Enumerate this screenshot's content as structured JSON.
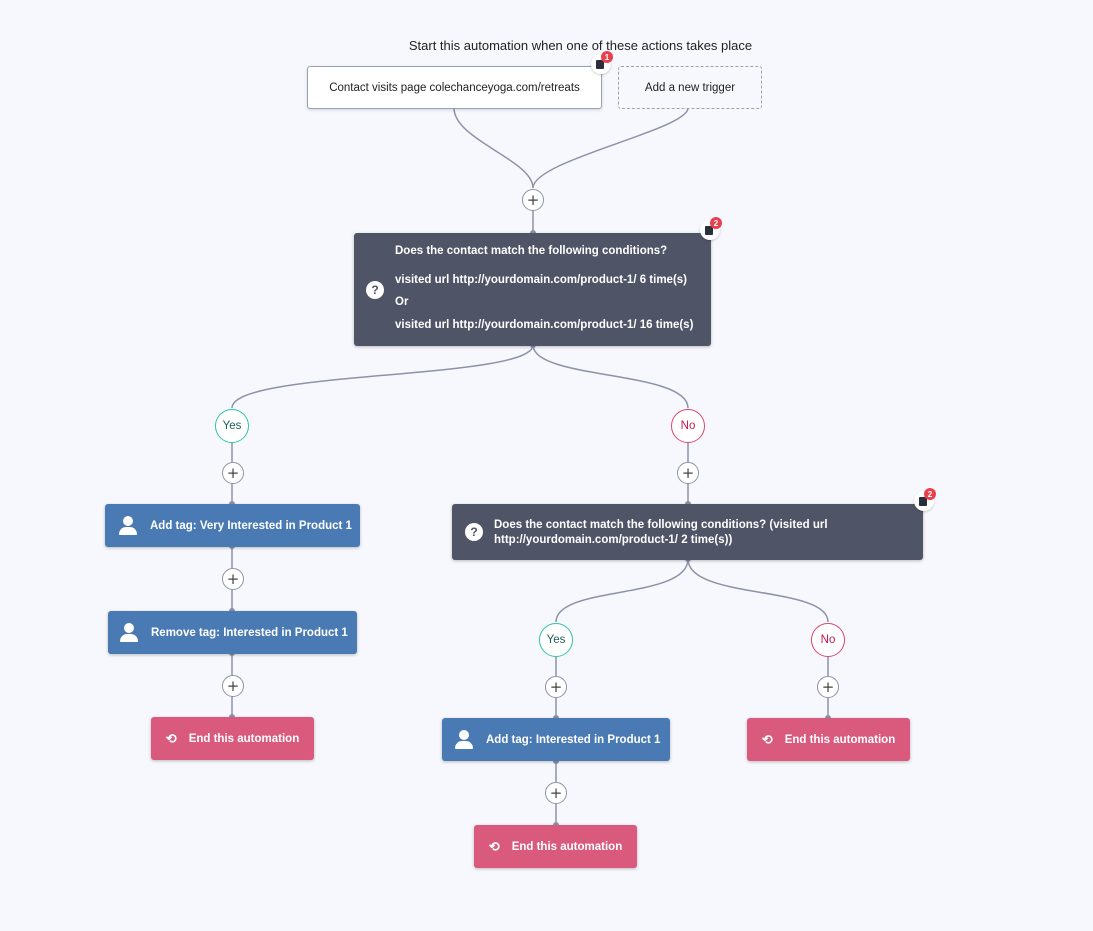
{
  "header": {
    "title": "Start this automation when one of these actions takes place"
  },
  "triggers": [
    {
      "label": "Contact visits page colechanceyoga.com/retreats",
      "badge_count": "1",
      "badge_icon": "note-icon"
    },
    {
      "label": "Add a new trigger"
    }
  ],
  "add_step_symbol": "+",
  "condition1": {
    "icon": "question-icon",
    "icon_glyph": "?",
    "badge_count": "2",
    "title": "Does the contact match the following conditions?",
    "lines": [
      "visited url http://yourdomain.com/product-1/ 6 time(s)",
      "Or",
      "visited url http://yourdomain.com/product-1/ 16 time(s)"
    ]
  },
  "branches": {
    "yes": "Yes",
    "no": "No"
  },
  "yes_path": {
    "actions": [
      {
        "label": "Add tag: Very Interested in Product 1",
        "icon": "user-icon"
      },
      {
        "label": "Remove tag: Interested in Product 1",
        "icon": "user-icon"
      }
    ],
    "end": {
      "label": "End this automation",
      "icon": "refresh-icon"
    }
  },
  "no_path": {
    "condition2": {
      "icon_glyph": "?",
      "badge_count": "2",
      "text": "Does the contact match the following conditions? (visited url http://yourdomain.com/product-1/ 2 time(s))"
    },
    "yes_path": {
      "action": {
        "label": "Add tag: Interested in Product 1",
        "icon": "user-icon"
      },
      "end": {
        "label": "End this automation",
        "icon": "refresh-icon"
      }
    },
    "no_path": {
      "end": {
        "label": "End this automation",
        "icon": "refresh-icon"
      }
    }
  },
  "colors": {
    "background": "#f7f8fd",
    "condition": "#4f5467",
    "action": "#4a7ab3",
    "end": "#da5a7e",
    "yes": "#2bc7a0",
    "no": "#e0416e",
    "connector": "#8c93a8"
  }
}
